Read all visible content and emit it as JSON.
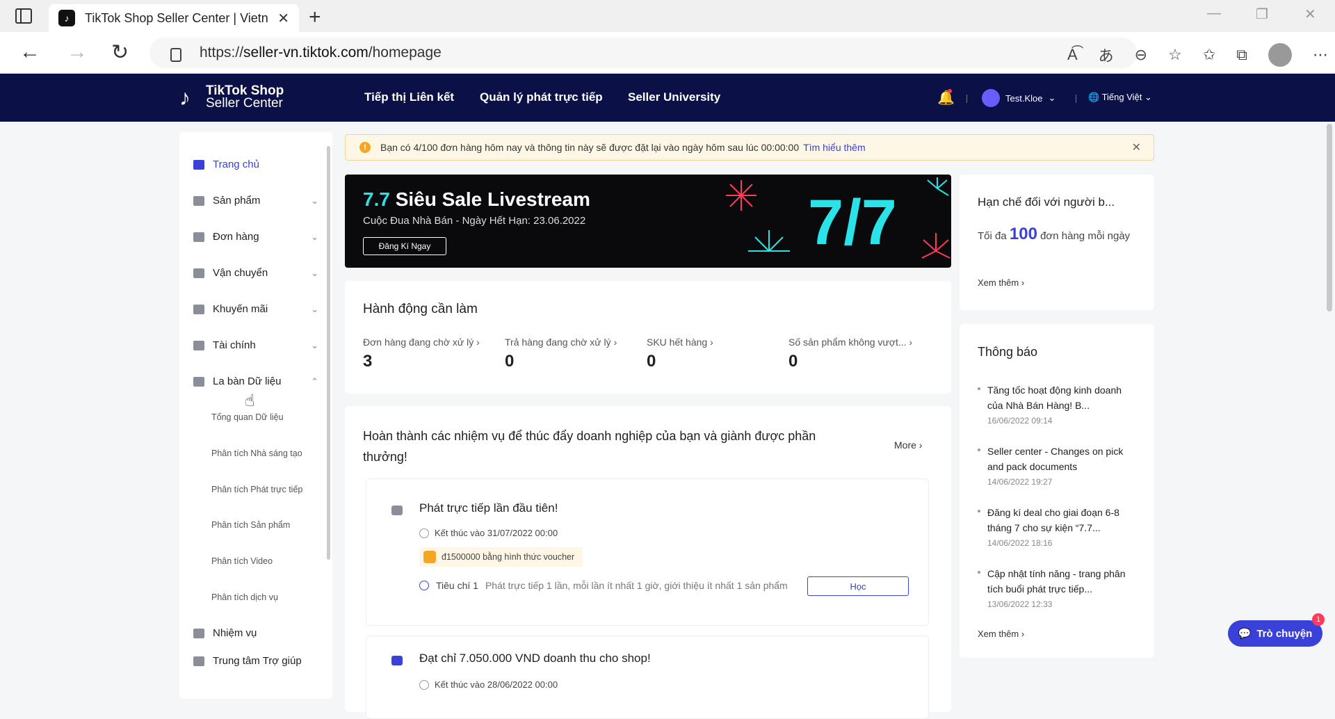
{
  "browser": {
    "tab_title": "TikTok Shop Seller Center | Vietn",
    "url_scheme": "https://",
    "url_host": "seller-vn.tiktok.com",
    "url_path": "/homepage"
  },
  "topnav": {
    "logo_line1": "TikTok Shop",
    "logo_line2": "Seller Center",
    "links": [
      "Tiếp thị Liên kết",
      "Quản lý phát trực tiếp",
      "Seller University"
    ],
    "user": "Test.Kloe",
    "language": "Tiếng Việt"
  },
  "sidebar": {
    "items": [
      {
        "label": "Trang chủ"
      },
      {
        "label": "Sản phẩm"
      },
      {
        "label": "Đơn hàng"
      },
      {
        "label": "Vận chuyển"
      },
      {
        "label": "Khuyến mãi"
      },
      {
        "label": "Tài chính"
      },
      {
        "label": "La bàn Dữ liệu"
      },
      {
        "label": "Nhiệm vụ"
      },
      {
        "label": "Trung tâm Trợ giúp"
      }
    ],
    "sub_items": [
      "Tổng quan Dữ liệu",
      "Phân tích Nhà sáng tạo",
      "Phân tích Phát trực tiếp",
      "Phân tích Sản phẩm",
      "Phân tích Video",
      "Phân tích dịch vụ"
    ]
  },
  "notice": {
    "text": "Bạn có 4/100 đơn hàng hôm nay và thông tin này sẽ được đặt lại vào ngày hôm sau lúc 00:00:00",
    "link": "Tìm hiểu thêm"
  },
  "banner": {
    "title_highlight": "7.7",
    "title": "Siêu Sale Livestream",
    "subtitle": "Cuộc Đua Nhà Bán - Ngày Hết Hạn: 23.06.2022",
    "button": "Đăng Kí Ngay",
    "art_text": "7/7"
  },
  "actions": {
    "title": "Hành động cần làm",
    "metrics": [
      {
        "label": "Đơn hàng đang chờ xử lý",
        "value": "3"
      },
      {
        "label": "Trả hàng đang chờ xử lý",
        "value": "0"
      },
      {
        "label": "SKU hết hàng",
        "value": "0"
      },
      {
        "label": "Số sản phẩm không vượt...",
        "value": "0"
      }
    ]
  },
  "tasks": {
    "title": "Hoàn thành các nhiệm vụ để thúc đẩy doanh nghiệp của bạn và giành được phần thưởng!",
    "more": "More",
    "items": [
      {
        "title": "Phát trực tiếp lần đầu tiên!",
        "end": "Kết thúc vào 31/07/2022 00:00",
        "reward": "đ1500000 bằng hình thức voucher",
        "criteria_label": "Tiêu chí 1",
        "criteria_desc": "Phát trực tiếp 1 lần, mỗi lần ít nhất 1 giờ, giới thiệu ít nhất 1 sản phẩm",
        "button": "Học"
      },
      {
        "title": "Đạt chỉ 7.050.000 VND doanh thu cho shop!",
        "end": "Kết thúc vào 28/06/2022 00:00"
      }
    ]
  },
  "limits": {
    "title": "Hạn chế đối với người b...",
    "text_before": "Tối đa",
    "number": "100",
    "text_after": "đơn hàng mỗi ngày",
    "see_more": "Xem thêm"
  },
  "announcements": {
    "title": "Thông báo",
    "items": [
      {
        "text": "Tăng tốc hoạt động kinh doanh của Nhà Bán Hàng! B...",
        "date": "16/06/2022 09:14"
      },
      {
        "text": "Seller center - Changes on pick and pack documents",
        "date": "14/06/2022 19:27"
      },
      {
        "text": "Đăng kí deal cho giai đoạn 6-8 tháng 7 cho sự kiện “7.7...",
        "date": "14/06/2022 18:16"
      },
      {
        "text": "Cập nhật tính năng - trang phân tích buổi phát trực tiếp...",
        "date": "13/06/2022 12:33"
      }
    ],
    "see_more": "Xem thêm"
  },
  "chat": {
    "label": "Trò chuyện",
    "badge": "1"
  },
  "colors": {
    "nav_bg": "#0b1147",
    "accent": "#3a41d8",
    "banner_cyan": "#29e3e8",
    "banner_pink": "#ff3b5c"
  }
}
